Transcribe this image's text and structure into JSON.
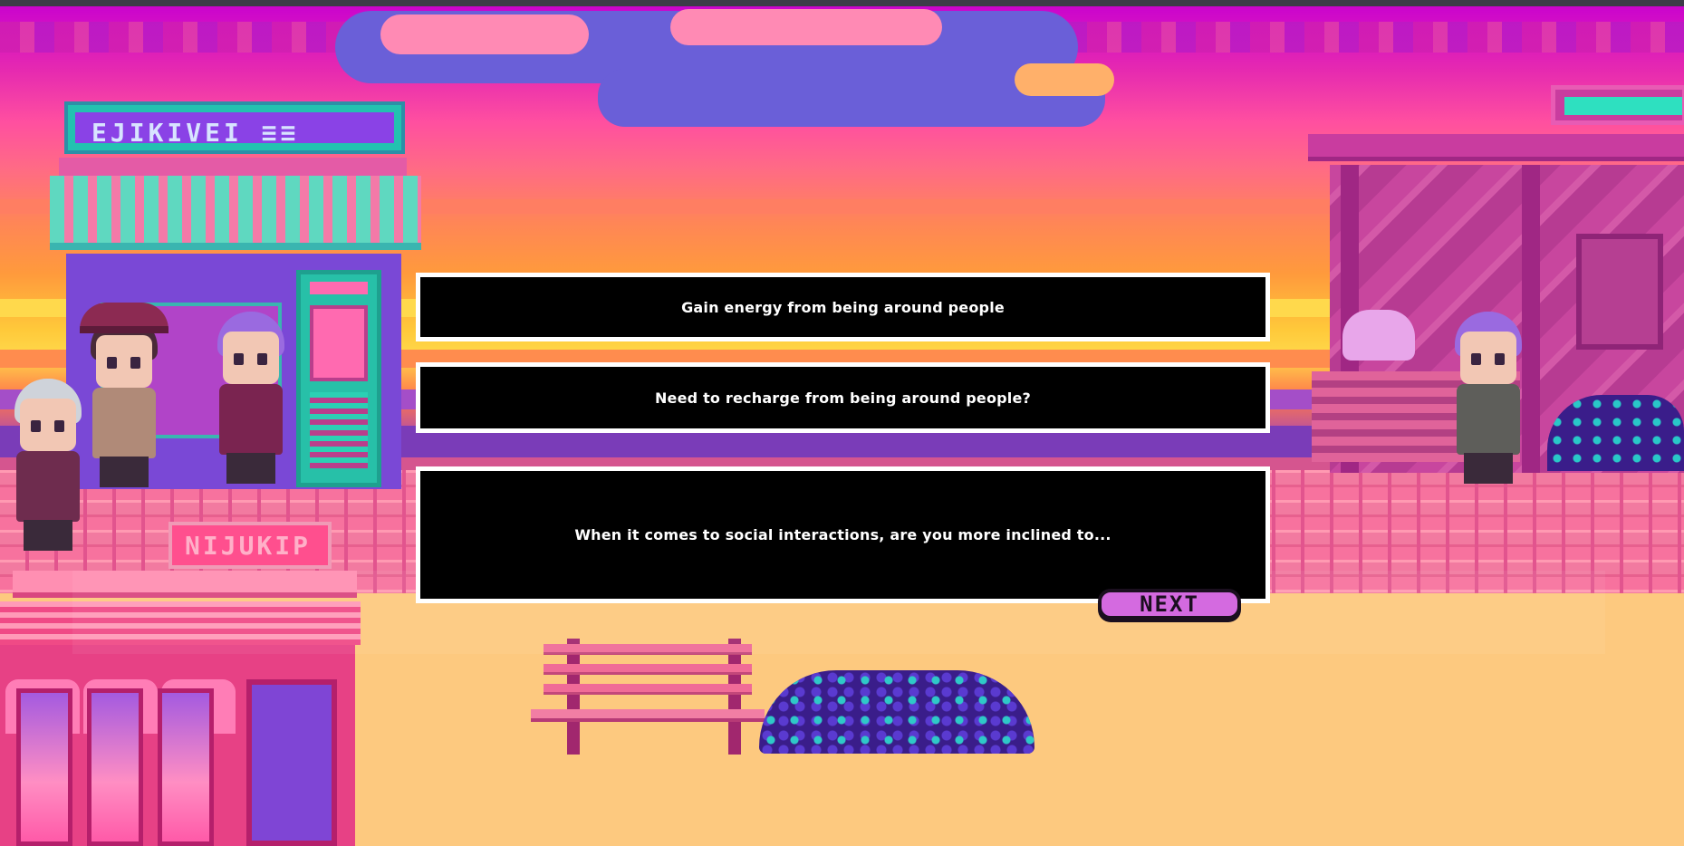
{
  "colors": {
    "dialog_bg": "#000000",
    "dialog_border": "#ffffff",
    "dialog_text": "#ffffff",
    "next_button_bg": "#d46ae0",
    "street": "#fdc97f"
  },
  "scenery": {
    "left_shop_sign": "EJIKIVEI ≡≡",
    "left_building_sign": "NIJUKIP",
    "icons": [
      "shop-awning",
      "bus-stop-shelter",
      "cat-sprite",
      "bench",
      "bush",
      "npc-sprite"
    ]
  },
  "dialog": {
    "options": [
      "Gain energy from being around people",
      "Need to recharge from being around people?"
    ],
    "prompt": "When it comes to social interactions, are you more inclined to...",
    "next_label": "NEXT"
  }
}
